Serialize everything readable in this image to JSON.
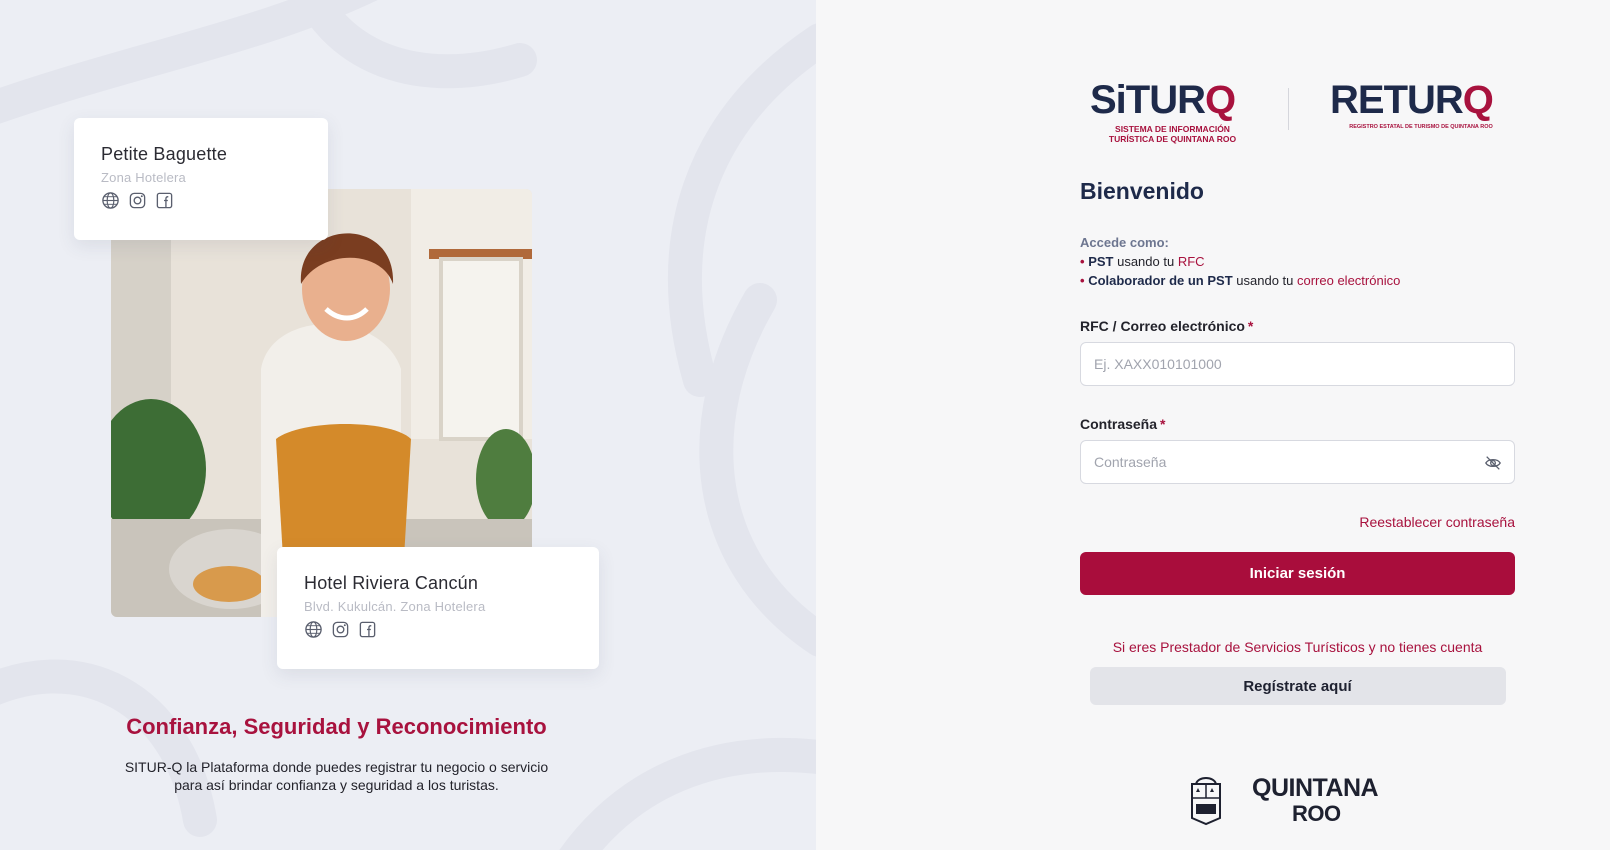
{
  "colors": {
    "accent": "#a8123e",
    "navy": "#1e2a4a",
    "left_bg": "#eceef4",
    "right_bg": "#f7f7f8"
  },
  "showcase": {
    "card_1": {
      "name": "Petite Baguette",
      "location": "Zona Hotelera",
      "icons": [
        "globe-icon",
        "instagram-icon",
        "facebook-icon"
      ]
    },
    "card_2": {
      "name": "Hotel Riviera Cancún",
      "location": "Blvd. Kukulcán. Zona Hotelera",
      "icons": [
        "globe-icon",
        "instagram-icon",
        "facebook-icon"
      ]
    },
    "tagline": "Confianza, Seguridad y Reconocimiento",
    "description": "SITUR-Q la Plataforma donde puedes registrar tu negocio o servicio para así brindar confianza y seguridad a los turistas."
  },
  "brand": {
    "situr": {
      "word_main": "SiTUR",
      "word_q": "Q",
      "subtitle_1": "SISTEMA DE INFORMACIÓN",
      "subtitle_2": "TURÍSTICA DE QUINTANA ROO"
    },
    "returo": {
      "word_main": "RETUR",
      "word_q": "Q",
      "subtitle": "REGISTRO ESTATAL DE TURISMO DE QUINTANA ROO"
    }
  },
  "login": {
    "title": "Bienvenido",
    "access_title": "Accede como:",
    "access_items": [
      {
        "bold": "PST",
        "mid": " usando tu ",
        "highlight": "RFC"
      },
      {
        "bold": "Colaborador de un PST",
        "mid": " usando tu ",
        "highlight": "correo electrónico"
      }
    ],
    "rfc_label": "RFC / Correo electrónico",
    "rfc_placeholder": "Ej. XAXX010101000",
    "password_label": "Contraseña",
    "password_placeholder": "Contraseña",
    "required_mark": "*",
    "forgot_password": "Reestablecer contraseña",
    "submit": "Iniciar sesión",
    "register_prompt": "Si eres Prestador de Servicios Turísticos y no tienes cuenta",
    "register_button": "Regístrate aquí"
  },
  "footer": {
    "qroo_line_1": "QUINTANA",
    "qroo_line_2": "ROO"
  }
}
